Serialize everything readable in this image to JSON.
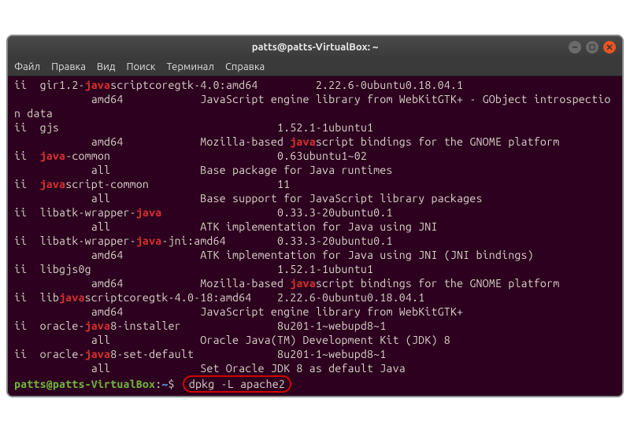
{
  "window": {
    "title": "patts@patts-VirtualBox: ~"
  },
  "menu": {
    "file": "Файл",
    "edit": "Правка",
    "view": "Вид",
    "search": "Поиск",
    "terminal": "Терминал",
    "help": "Справка"
  },
  "pkgs": {
    "p1": {
      "ii": "ii  ",
      "pre": "gir1.2-",
      "hl": "java",
      "post": "scriptcoregtk-4.0:amd64",
      "ver": "2.22.6-0ubuntu0.18.04.1",
      "arch": "amd64",
      "desc": "JavaScript engine library from WebKitGTK+ - GObject introspection data",
      "pad1": "         ",
      "pad2": "            "
    },
    "p2": {
      "ii": "ii  ",
      "pre": "gjs",
      "hl": "",
      "post": "",
      "ver": "1.52.1-1ubuntu1",
      "arch": "amd64",
      "desc1": "Mozilla-based ",
      "deschl": "java",
      "desc2": "script bindings for the GNOME platform",
      "pad1": "                                  ",
      "pad2": "            "
    },
    "p3": {
      "ii": "ii  ",
      "pre": "",
      "hl": "java",
      "post": "-common",
      "ver": "0.63ubuntu1~02",
      "arch": "all",
      "desc": "Base package for Java runtimes",
      "pad1": "                          ",
      "pad2": "              "
    },
    "p4": {
      "ii": "ii  ",
      "pre": "",
      "hl": "java",
      "post": "script-common",
      "ver": "11",
      "arch": "all",
      "desc": "Base support for JavaScript library packages",
      "pad1": "                    ",
      "pad2": "              "
    },
    "p5": {
      "ii": "ii  ",
      "pre": "libatk-wrapper-",
      "hl": "java",
      "post": "",
      "ver": "0.33.3-20ubuntu0.1",
      "arch": "all",
      "desc": "ATK implementation for Java using JNI",
      "pad1": "                  ",
      "pad2": "              "
    },
    "p6": {
      "ii": "ii  ",
      "pre": "libatk-wrapper-",
      "hl": "java",
      "post": "-jni:amd64",
      "ver": "0.33.3-20ubuntu0.1",
      "arch": "amd64",
      "desc": "ATK implementation for Java using JNI (JNI bindings)",
      "pad1": "        ",
      "pad2": "            "
    },
    "p7": {
      "ii": "ii  ",
      "pre": "libgjs0g",
      "hl": "",
      "post": "",
      "ver": "1.52.1-1ubuntu1",
      "arch": "amd64",
      "desc1": "Mozilla-based ",
      "deschl": "java",
      "desc2": "script bindings for the GNOME platform",
      "pad1": "                             ",
      "pad2": "            "
    },
    "p8": {
      "ii": "ii  ",
      "pre": "lib",
      "hl": "java",
      "post": "scriptcoregtk-4.0-18:amd64",
      "ver": "2.22.6-0ubuntu0.18.04.1",
      "arch": "amd64",
      "desc": "JavaScript engine library from WebKitGTK+",
      "pad1": "    ",
      "pad2": "            "
    },
    "p9": {
      "ii": "ii  ",
      "pre": "oracle-",
      "hl": "java",
      "post": "8-installer",
      "ver": "8u201-1~webupd8~1",
      "arch": "all",
      "desc": "Oracle Java(TM) Development Kit (JDK) 8",
      "pad1": "               ",
      "pad2": "              "
    },
    "p10": {
      "ii": "ii  ",
      "pre": "oracle-",
      "hl": "java",
      "post": "8-set-default",
      "ver": "8u201-1~webupd8~1",
      "arch": "all",
      "desc": "Set Oracle JDK 8 as default Java",
      "pad1": "             ",
      "pad2": "              "
    }
  },
  "prompt": {
    "userhost": "patts@patts-VirtualBox",
    "colon": ":",
    "path": "~",
    "dollar": "$",
    "command": "dpkg -L apache2"
  }
}
